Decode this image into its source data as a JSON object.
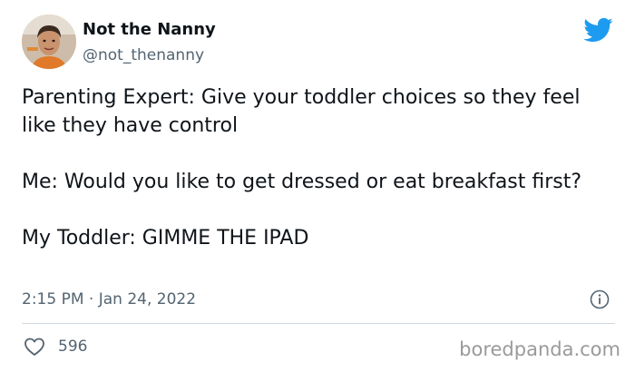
{
  "author": {
    "display_name": "Not the Nanny",
    "handle": "@not_thenanny"
  },
  "tweet": {
    "paragraphs": [
      "Parenting Expert: Give your toddler choices so they feel like they have control",
      "Me: Would you like to get dressed or eat breakfast first?",
      "My Toddler: GIMME THE IPAD"
    ],
    "timestamp": "2:15 PM · Jan 24, 2022"
  },
  "engagement": {
    "likes": "596"
  },
  "watermark": "boredpanda.com",
  "colors": {
    "twitter_blue": "#1d9bf0",
    "text_primary": "#0f1419",
    "text_secondary": "#536471",
    "divider": "#cfd9de"
  },
  "icons": {
    "brand": "twitter-bird-icon",
    "info": "info-icon",
    "like": "heart-icon"
  }
}
